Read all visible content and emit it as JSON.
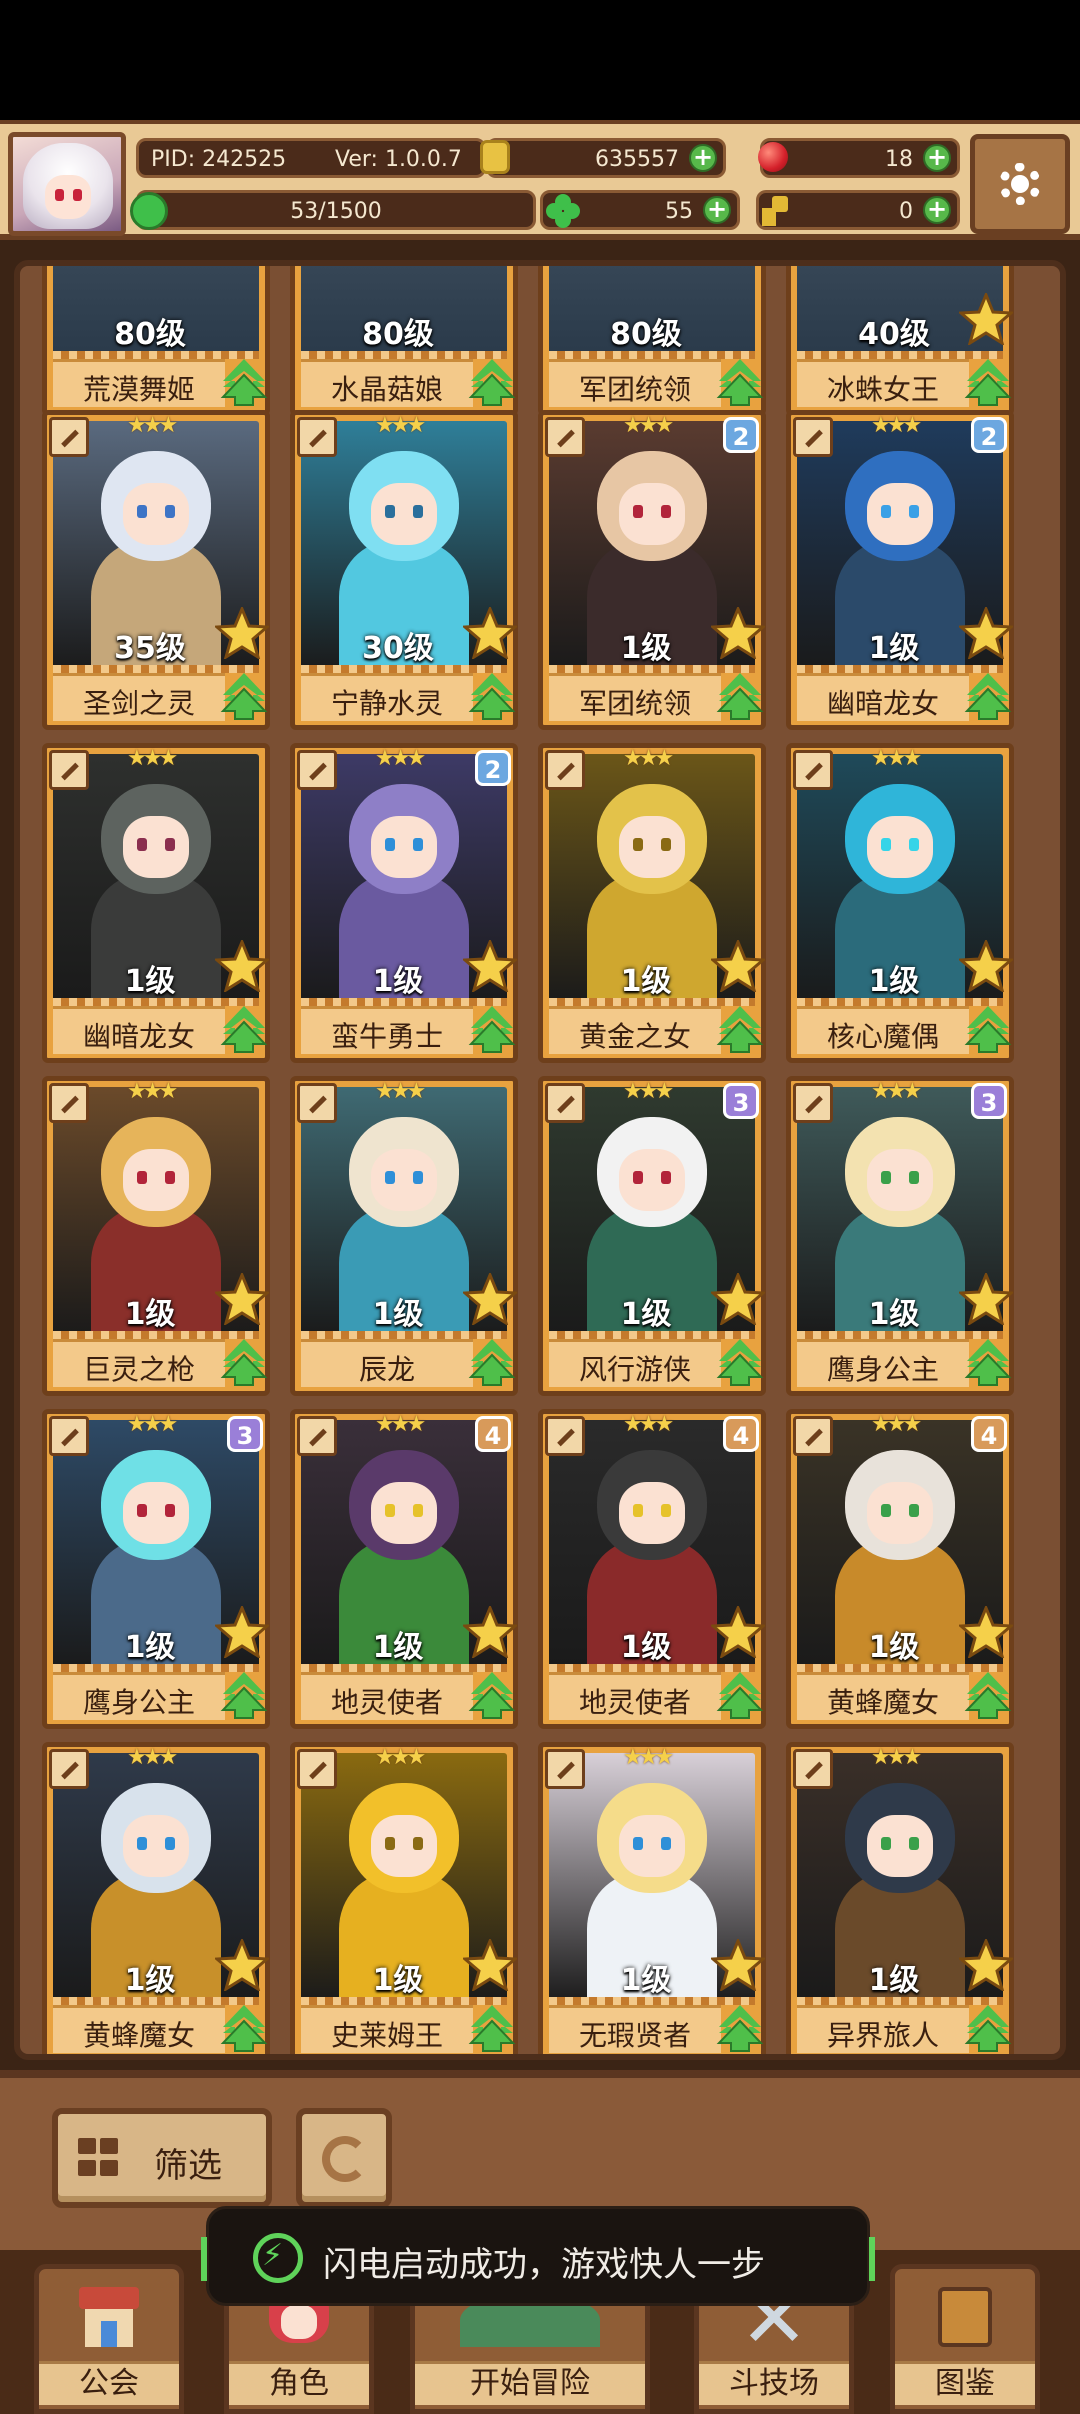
{
  "header": {
    "pid": "PID: 242525",
    "version": "Ver: 1.0.0.7",
    "xp": "53/1500",
    "gold": "635557",
    "gems": "18",
    "clovers": "55",
    "keys": "0"
  },
  "top_row": [
    {
      "level": "80级",
      "name": "荒漠舞姬"
    },
    {
      "level": "80级",
      "name": "水晶菇娘"
    },
    {
      "level": "80级",
      "name": "军团统领"
    },
    {
      "level": "40级",
      "name": "冰蛛女王"
    }
  ],
  "cards": [
    {
      "level": "35级",
      "name": "圣剑之灵",
      "rank": "",
      "rank_color": "",
      "hair": "#dfe6f2",
      "bg": "#5a6a7f",
      "body": "#c5a77a",
      "eye": "#3d74c6"
    },
    {
      "level": "30级",
      "name": "宁静水灵",
      "rank": "",
      "rank_color": "",
      "hair": "#7fdff2",
      "bg": "#2f7f99",
      "body": "#52c8e0",
      "eye": "#2a6f9c"
    },
    {
      "level": "1级",
      "name": "军团统领",
      "rank": "2",
      "rank_color": "#6ca7e0",
      "hair": "#e7c6a4",
      "bg": "#5a3b30",
      "body": "#3b2b2b",
      "eye": "#b2243a"
    },
    {
      "level": "1级",
      "name": "幽暗龙女",
      "rank": "2",
      "rank_color": "#6ca7e0",
      "hair": "#2f6fc0",
      "bg": "#1f3b5c",
      "body": "#2b4a6a",
      "eye": "#3aa0e6"
    },
    {
      "level": "1级",
      "name": "幽暗龙女",
      "rank": "",
      "rank_color": "",
      "hair": "#5d635f",
      "bg": "#2e302e",
      "body": "#3a3b3a",
      "eye": "#8b2f4f"
    },
    {
      "level": "1级",
      "name": "蛮牛勇士",
      "rank": "2",
      "rank_color": "#6ca7e0",
      "hair": "#8e7fc7",
      "bg": "#3d3a66",
      "body": "#6a5aa0",
      "eye": "#2e8fd8"
    },
    {
      "level": "1级",
      "name": "黄金之女",
      "rank": "",
      "rank_color": "",
      "hair": "#e3c24a",
      "bg": "#6b5618",
      "body": "#cfa72f",
      "eye": "#8a6a14"
    },
    {
      "level": "1级",
      "name": "核心魔偶",
      "rank": "",
      "rank_color": "",
      "hair": "#2fb5d9",
      "bg": "#1f4a5a",
      "body": "#2b6b7b",
      "eye": "#35d4e8"
    },
    {
      "level": "1级",
      "name": "巨灵之枪",
      "rank": "",
      "rank_color": "",
      "hair": "#e6b45a",
      "bg": "#6b4a2a",
      "body": "#8a2f2a",
      "eye": "#b2243a"
    },
    {
      "level": "1级",
      "name": "辰龙",
      "rank": "",
      "rank_color": "",
      "hair": "#efe4cf",
      "bg": "#3f6a73",
      "body": "#3a9bb5",
      "eye": "#2e8fd8"
    },
    {
      "level": "1级",
      "name": "风行游侠",
      "rank": "3",
      "rank_color": "#9a7fd8",
      "hair": "#f2f2f2",
      "bg": "#2f3a2f",
      "body": "#2f6a55",
      "eye": "#b2243a"
    },
    {
      "level": "1级",
      "name": "鹰身公主",
      "rank": "3",
      "rank_color": "#9a7fd8",
      "hair": "#f3e2b0",
      "bg": "#3f5a5a",
      "body": "#3a7a7a",
      "eye": "#3aa04a"
    },
    {
      "level": "1级",
      "name": "鹰身公主",
      "rank": "3",
      "rank_color": "#9a7fd8",
      "hair": "#6fe0e6",
      "bg": "#2e4a66",
      "body": "#4b6a8a",
      "eye": "#b2243a"
    },
    {
      "level": "1级",
      "name": "地灵使者",
      "rank": "4",
      "rank_color": "#d89a5a",
      "hair": "#5a3a6a",
      "bg": "#3a2f3a",
      "body": "#3b8a3a",
      "eye": "#e6c22a"
    },
    {
      "level": "1级",
      "name": "地灵使者",
      "rank": "4",
      "rank_color": "#d89a5a",
      "hair": "#3a3a3a",
      "bg": "#2a2a2a",
      "body": "#8a2a2a",
      "eye": "#e6c22a"
    },
    {
      "level": "1级",
      "name": "黄蜂魔女",
      "rank": "4",
      "rank_color": "#d89a5a",
      "hair": "#e8e2da",
      "bg": "#3a3326",
      "body": "#c88a2a",
      "eye": "#3aa04a"
    },
    {
      "level": "1级",
      "name": "黄蜂魔女",
      "rank": "",
      "rank_color": "",
      "hair": "#d8e2ec",
      "bg": "#2f3a4a",
      "body": "#c8902a",
      "eye": "#2e8fd8"
    },
    {
      "level": "1级",
      "name": "史莱姆王",
      "rank": "",
      "rank_color": "",
      "hair": "#f2c02a",
      "bg": "#8a6a10",
      "body": "#e6b020",
      "eye": "#8a6a14"
    },
    {
      "level": "1级",
      "name": "无瑕贤者",
      "rank": "",
      "rank_color": "",
      "hair": "#f5dc8a",
      "bg": "#d8d0d8",
      "body": "#eef2f6",
      "eye": "#2e8fd8"
    },
    {
      "level": "1级",
      "name": "异界旅人",
      "rank": "",
      "rank_color": "",
      "hair": "#2f3a4a",
      "bg": "#3a2f28",
      "body": "#6a4a2a",
      "eye": "#3aa04a"
    }
  ],
  "controls": {
    "filter_label": "筛选"
  },
  "toast": {
    "message": "闪电启动成功，游戏快人一步"
  },
  "nav": {
    "items": [
      "公会",
      "角色",
      "开始冒险",
      "斗技场",
      "图鉴"
    ]
  },
  "colors": {
    "card_frame": "#e8a23f",
    "star": "#f5d04a",
    "up_arrow": "#4fbf4a",
    "board": "#7a4f33"
  }
}
